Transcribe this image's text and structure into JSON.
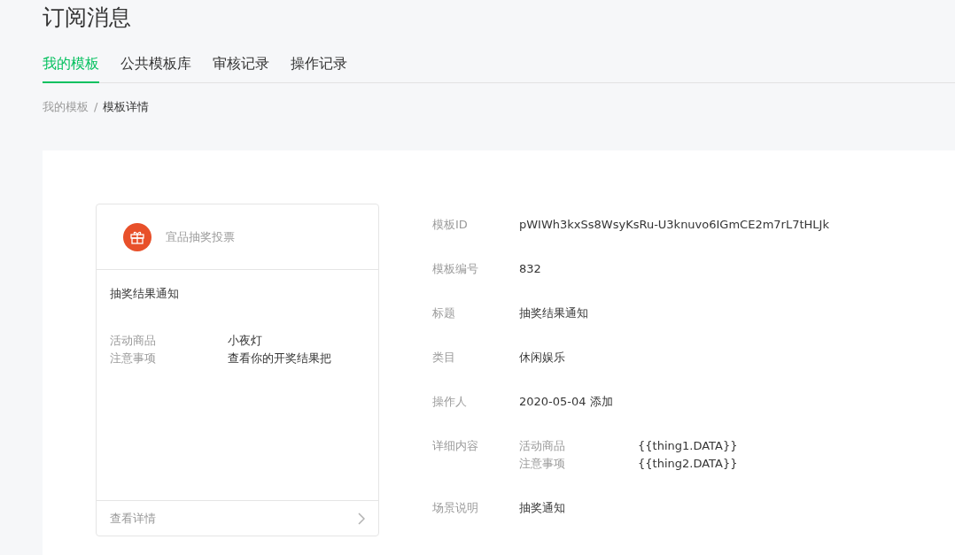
{
  "page_title": "订阅消息",
  "tabs": [
    {
      "label": "我的模板",
      "selected": true
    },
    {
      "label": "公共模板库",
      "selected": false
    },
    {
      "label": "审核记录",
      "selected": false
    },
    {
      "label": "操作记录",
      "selected": false
    }
  ],
  "breadcrumb": [
    "我的模板",
    "模板详情"
  ],
  "breadcrumb_separator": "/",
  "preview": {
    "app_name": "宜品抽奖投票",
    "title": "抽奖结果通知",
    "fields": [
      {
        "label": "活动商品",
        "value": "小夜灯"
      },
      {
        "label": "注意事项",
        "value": "查看你的开奖结果把"
      }
    ],
    "footer_link": "查看详情"
  },
  "details": [
    {
      "kind": "text",
      "label": "模板ID",
      "value": "pWIWh3kxSs8WsyKsRu-U3knuvo6IGmCE2m7rL7tHLJk"
    },
    {
      "kind": "text",
      "label": "模板编号",
      "value": "832"
    },
    {
      "kind": "text",
      "label": "标题",
      "value": "抽奖结果通知"
    },
    {
      "kind": "text",
      "label": "类目",
      "value": "休闲娱乐"
    },
    {
      "kind": "text",
      "label": "操作人",
      "value": "2020-05-04 添加"
    },
    {
      "kind": "fields",
      "label": "详细内容",
      "fields": [
        {
          "name": "活动商品",
          "value": "{{thing1.DATA}}"
        },
        {
          "name": "注意事项",
          "value": "{{thing2.DATA}}"
        }
      ]
    },
    {
      "kind": "text",
      "label": "场景说明",
      "value": "抽奖通知"
    }
  ]
}
